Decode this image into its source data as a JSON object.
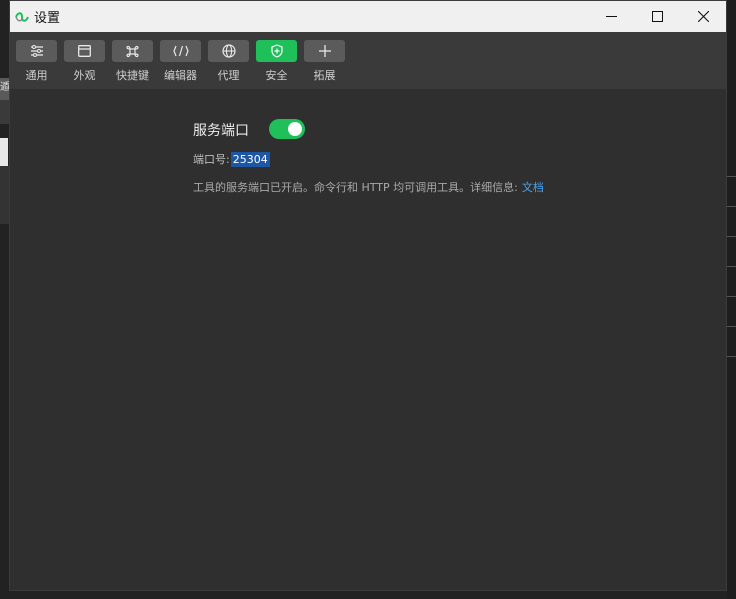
{
  "window": {
    "title": "设置"
  },
  "background": {
    "fragment_char": "遁"
  },
  "toolbar": {
    "items": [
      {
        "label": "通用",
        "icon": "list-settings-icon",
        "active": false
      },
      {
        "label": "外观",
        "icon": "window-icon",
        "active": false
      },
      {
        "label": "快捷键",
        "icon": "command-key-icon",
        "active": false
      },
      {
        "label": "编辑器",
        "icon": "code-brackets-icon",
        "active": false
      },
      {
        "label": "代理",
        "icon": "globe-icon",
        "active": false
      },
      {
        "label": "安全",
        "icon": "shield-icon",
        "active": true
      },
      {
        "label": "拓展",
        "icon": "plus-icon",
        "active": false
      }
    ]
  },
  "service_port": {
    "title": "服务端口",
    "enabled": true,
    "port_label": "端口号:",
    "port_value": "25304",
    "info_text": "工具的服务端口已开启。命令行和 HTTP 均可调用工具。详细信息:",
    "info_link": "文档"
  },
  "colors": {
    "accent": "#1fbf5a",
    "link": "#4aa3f0",
    "selection": "#1e56a6",
    "panel": "#2f2f2f",
    "toolbar": "#3a3a3a"
  }
}
